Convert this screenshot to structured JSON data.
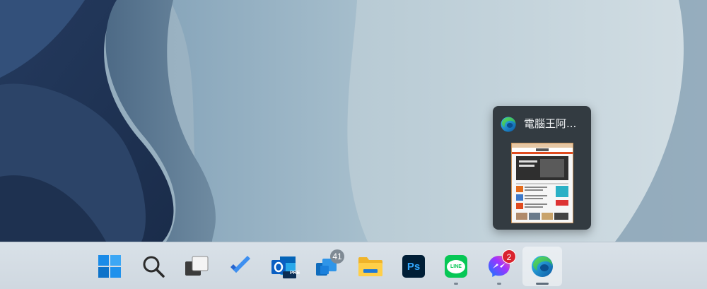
{
  "preview": {
    "title": "電腦王阿...",
    "app_icon": "edge-icon"
  },
  "taskbar": {
    "items": [
      {
        "name": "start",
        "icon": "windows-logo-icon"
      },
      {
        "name": "search",
        "icon": "search-icon"
      },
      {
        "name": "task-view",
        "icon": "task-view-icon"
      },
      {
        "name": "todo",
        "icon": "todo-check-icon"
      },
      {
        "name": "outlook",
        "icon": "outlook-icon",
        "label": "PRE"
      },
      {
        "name": "onedrive",
        "icon": "onedrive-icon",
        "badge": "41"
      },
      {
        "name": "file-explorer",
        "icon": "folder-icon"
      },
      {
        "name": "photoshop",
        "icon": "photoshop-icon",
        "label": "Ps"
      },
      {
        "name": "line",
        "icon": "line-icon",
        "label": "LINE"
      },
      {
        "name": "messenger",
        "icon": "messenger-icon",
        "badge": "2"
      },
      {
        "name": "edge",
        "icon": "edge-icon"
      }
    ]
  },
  "colors": {
    "accent": "#0078d4",
    "preview_bg": "#333b41",
    "badge_red": "#d9232e"
  }
}
